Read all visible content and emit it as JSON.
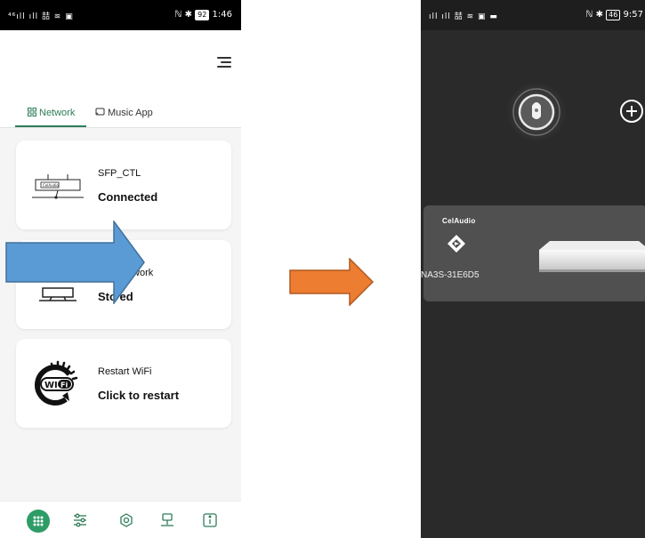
{
  "left_phone": {
    "status": {
      "left": "⁴⁶ıll ıll 喆 ≋ ▣",
      "right_icons": "ℕ ✱",
      "battery": "92",
      "time": "1:46"
    },
    "tabs": [
      {
        "label": "Network",
        "active": true,
        "icon": "grid-icon"
      },
      {
        "label": "Music App",
        "active": false,
        "icon": "cast-icon"
      }
    ],
    "cards": [
      {
        "title": "SFP_CTL",
        "subtitle": "Connected",
        "icon": "device-icon"
      },
      {
        "title": "twork",
        "subtitle": "Sto  ed",
        "icon": "monitor-icon"
      },
      {
        "title": "Restart WiFi",
        "subtitle": "Click to restart",
        "icon": "wifi-restart-icon"
      }
    ],
    "device_brand_mini": "CelAudio",
    "bottom_nav": [
      "home-grid-icon",
      "sliders-icon",
      "settings-icon",
      "network-icon",
      "info-icon"
    ],
    "accent": "#2e7d59"
  },
  "arrows": [
    {
      "color": "#5b9bd5",
      "icon": "arrow-right-icon"
    },
    {
      "color": "#ed7d31",
      "icon": "arrow-right-icon"
    }
  ],
  "right_phone": {
    "status": {
      "left": "ıll ıll 喆 ≋ ▣ ▬",
      "right_icons": "ℕ ✱",
      "battery": "46",
      "time": "9:57"
    },
    "device": {
      "brand": "CelAudio",
      "id": "NA3S-31E6D5"
    },
    "background": "#2a2a2a"
  }
}
